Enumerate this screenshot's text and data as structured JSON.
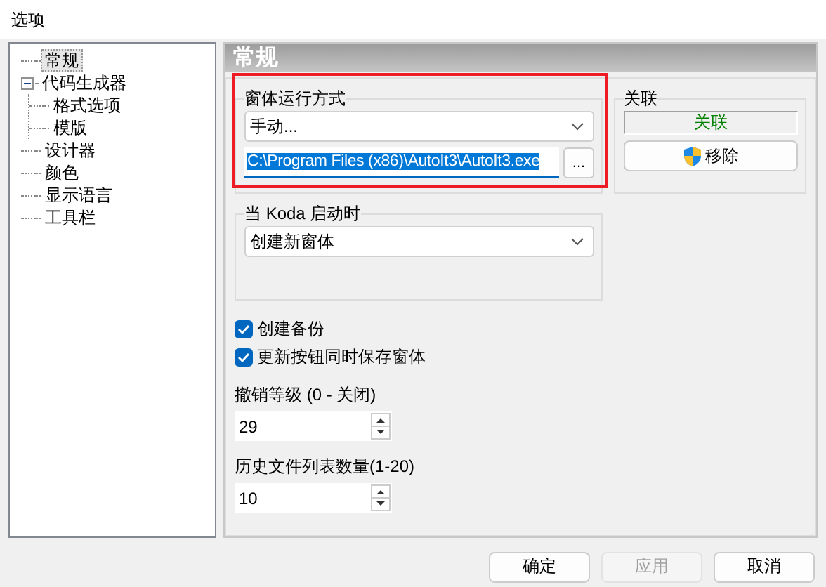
{
  "window": {
    "title": "选项"
  },
  "tree": [
    {
      "label": "常规",
      "selected": true
    },
    {
      "label": "代码生成器",
      "selected": false,
      "expanded": true,
      "children": [
        {
          "label": "格式选项",
          "selected": false
        },
        {
          "label": "模版",
          "selected": false
        }
      ]
    },
    {
      "label": "设计器",
      "selected": false
    },
    {
      "label": "颜色",
      "selected": false
    },
    {
      "label": "显示语言",
      "selected": false
    },
    {
      "label": "工具栏",
      "selected": false
    }
  ],
  "section_title": "常规",
  "run_mode": {
    "title": "窗体运行方式",
    "value": "手动...",
    "path": "C:\\Program Files (x86)\\AutoIt3\\AutoIt3.exe",
    "browse": "..."
  },
  "association": {
    "title": "关联",
    "status": "关联",
    "button": "移除"
  },
  "on_start": {
    "title": "当 Koda 启动时",
    "value": "创建新窗体"
  },
  "checkboxes": [
    {
      "label": "创建备份",
      "checked": true
    },
    {
      "label": "更新按钮同时保存窗体",
      "checked": true
    }
  ],
  "spinners": [
    {
      "label": "撤销等级 (0 - 关闭)",
      "value": "29"
    },
    {
      "label": "历史文件列表数量(1-20)",
      "value": "10"
    }
  ],
  "buttons": [
    {
      "label": "确定",
      "disabled": false
    },
    {
      "label": "应用",
      "disabled": true
    },
    {
      "label": "取消",
      "disabled": false
    }
  ]
}
